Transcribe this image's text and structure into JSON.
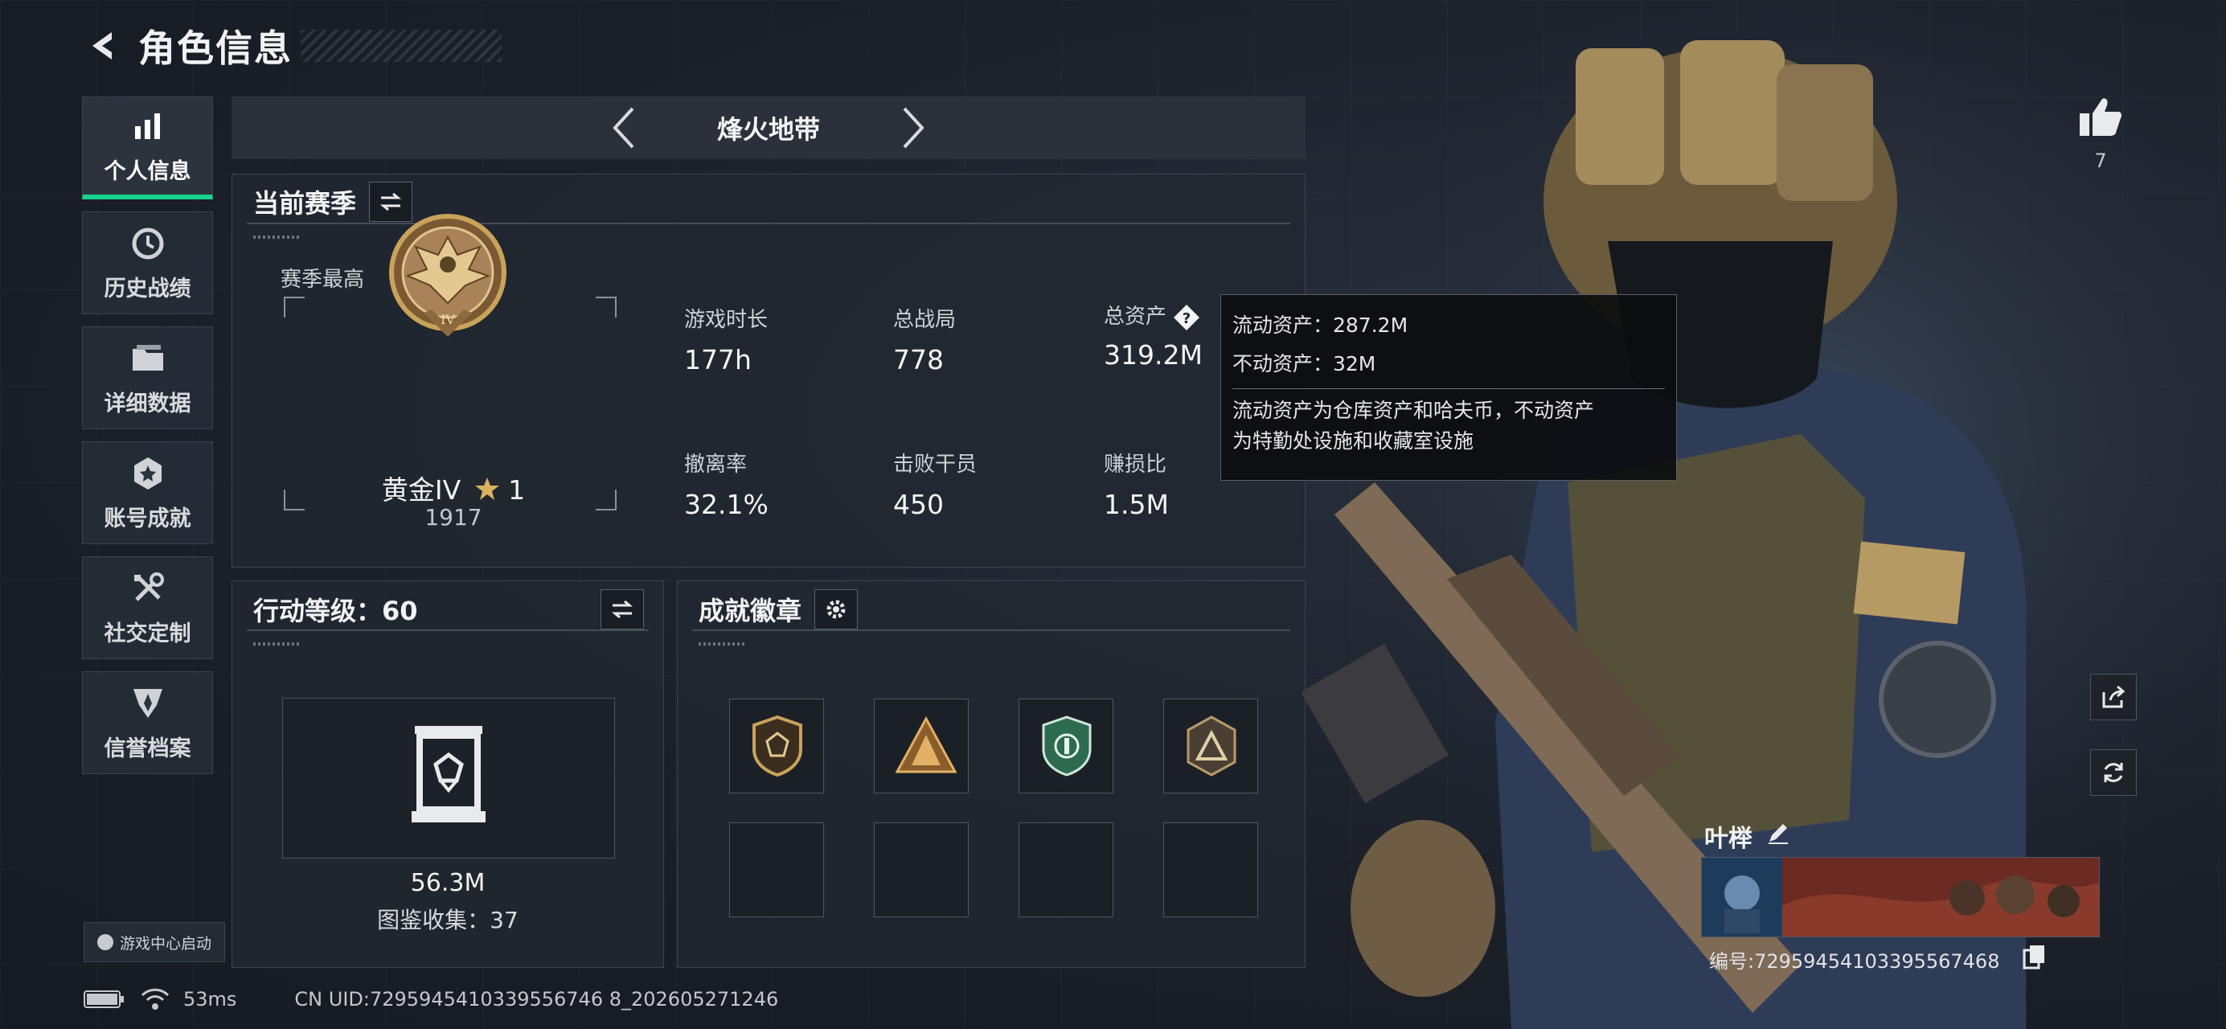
{
  "header": {
    "title": "角色信息"
  },
  "sidebar": {
    "items": [
      {
        "label": "个人信息",
        "icon": "bar-chart-icon",
        "active": true
      },
      {
        "label": "历史战绩",
        "icon": "history-clock-icon"
      },
      {
        "label": "详细数据",
        "icon": "folder-icon"
      },
      {
        "label": "账号成就",
        "icon": "achievement-medal-icon"
      },
      {
        "label": "社交定制",
        "icon": "tools-icon"
      },
      {
        "label": "信誉档案",
        "icon": "credit-shield-icon"
      }
    ],
    "launch_chip": "游戏中心启动"
  },
  "mode": {
    "title": "烽火地带"
  },
  "season": {
    "title": "当前赛季",
    "peak_label": "赛季最高",
    "rank_name": "黄金IV",
    "rank_stars": "1",
    "rank_score": "1917",
    "stats": [
      {
        "label": "游戏时长",
        "value": "177h"
      },
      {
        "label": "总战局",
        "value": "778"
      },
      {
        "label": "总资产",
        "value": "319.2M"
      },
      {
        "label": "撤离率",
        "value": "32.1%"
      },
      {
        "label": "击败干员",
        "value": "450"
      },
      {
        "label": "赚损比",
        "value": "1.5M"
      }
    ]
  },
  "tooltip": {
    "liquid": "流动资产：287.2M",
    "fixed": "不动资产：32M",
    "desc_line1": "流动资产为仓库资产和哈夫币，不动资产",
    "desc_line2": "为特勤处设施和收藏室设施"
  },
  "level": {
    "title": "行动等级：60",
    "value": "56.3M",
    "collection": "图鉴收集：37"
  },
  "badges": {
    "title": "成就徽章",
    "slots": [
      {
        "icon": "shield-badge-icon",
        "filled": true
      },
      {
        "icon": "pyramid-badge-icon",
        "filled": true
      },
      {
        "icon": "green-shield-badge-icon",
        "filled": true
      },
      {
        "icon": "triangle-badge-icon",
        "filled": true
      },
      {
        "filled": false
      },
      {
        "filled": false
      },
      {
        "filled": false
      },
      {
        "filled": false
      }
    ]
  },
  "profile": {
    "likes": "7",
    "name": "叶榉",
    "id": "编号:7295945410339556746​8"
  },
  "status": {
    "ping": "53ms",
    "uid": "CN UID:7295945410339556746 8_202605271246"
  },
  "colors": {
    "accent": "#17d28b",
    "gold": "#c9a35a"
  }
}
